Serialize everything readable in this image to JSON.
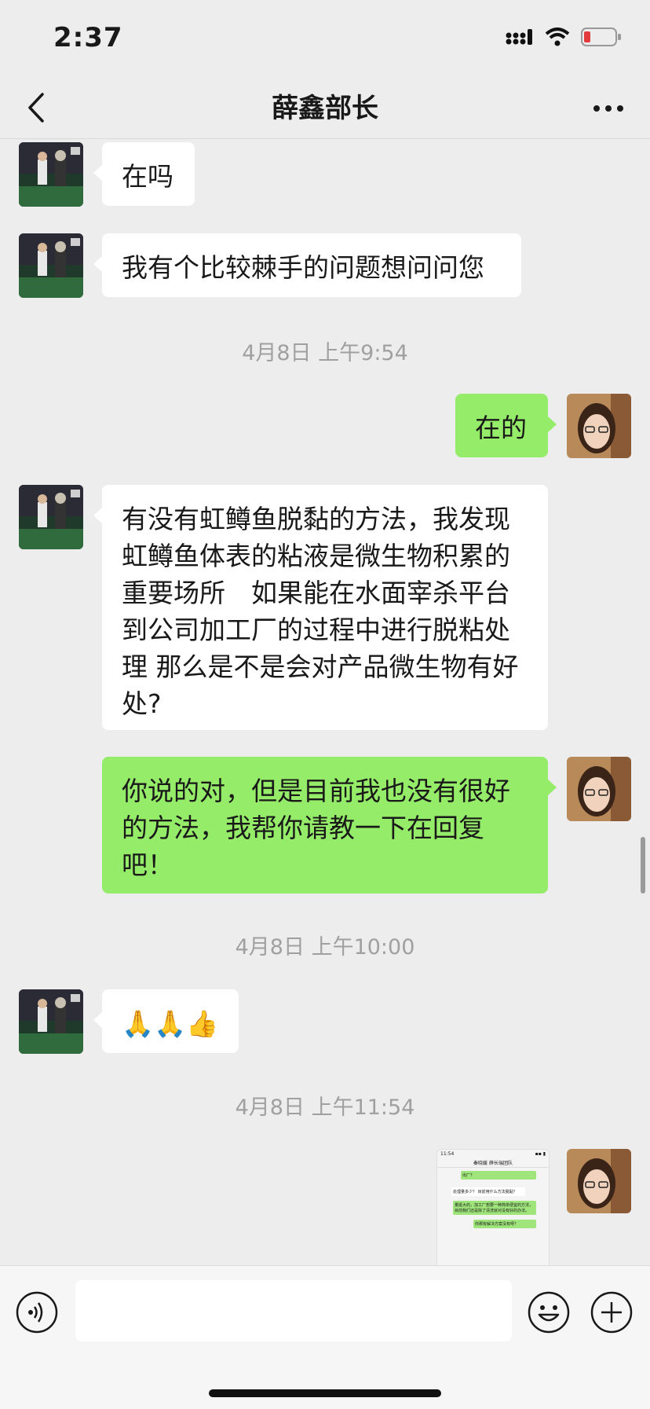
{
  "status_bar": {
    "time": "2:37",
    "battery_color": "#e33b3b"
  },
  "header": {
    "title": "薛鑫部长",
    "back_icon": "chevron-left-icon",
    "more_icon": "more-dots-icon"
  },
  "messages": [
    {
      "side": "in",
      "text": "在吗"
    },
    {
      "side": "in",
      "text": "我有个比较棘手的问题想问问您"
    },
    {
      "type": "timestamp",
      "text": "4月8日 上午9:54"
    },
    {
      "side": "out",
      "text": "在的"
    },
    {
      "side": "in",
      "text": "有没有虹鳟鱼脱黏的方法，我发现虹鳟鱼体表的粘液是微生物积累的重要场所　如果能在水面宰杀平台到公司加工厂的过程中进行脱粘处理  那么是不是会对产品微生物有好处?"
    },
    {
      "side": "out",
      "text": "你说的对，但是目前我也没有很好的方法，我帮你请教一下在回复吧！"
    },
    {
      "type": "timestamp",
      "text": "4月8日 上午10:00"
    },
    {
      "side": "in",
      "text": "🙏🙏👍"
    },
    {
      "type": "timestamp",
      "text": "4月8日 上午11:54"
    },
    {
      "side": "out",
      "type": "image",
      "thumb": {
        "time": "11:54",
        "title": "秦晓媛 薛长瑞团队",
        "lines": [
          "出厂？",
          "处理量多少？ 目前用什么方法脱黏？",
          "量挺大的，加工厂想要一种简单便宜的方法，目前我们还是除了清洗就对没有好的办法。",
          "你那有解决方案没有呀？"
        ]
      }
    }
  ],
  "input_bar": {
    "voice_icon": "voice-icon",
    "emoji_icon": "emoji-icon",
    "plus_icon": "plus-icon",
    "placeholder": ""
  },
  "colors": {
    "background": "#ededed",
    "incoming_bubble": "#ffffff",
    "outgoing_bubble": "#95ec69",
    "timestamp": "#a0a0a0"
  }
}
